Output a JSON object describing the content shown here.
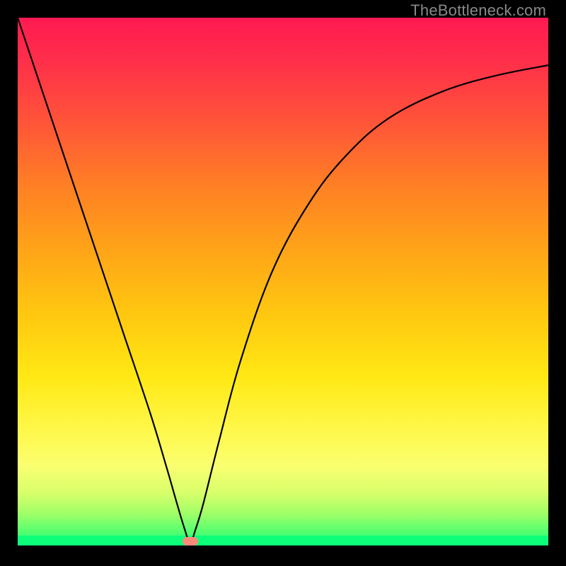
{
  "watermark": "TheBottleneck.com",
  "chart_data": {
    "type": "line",
    "title": "",
    "xlabel": "",
    "ylabel": "",
    "xlim": [
      0,
      100
    ],
    "ylim": [
      0,
      100
    ],
    "grid": false,
    "legend": false,
    "gradient_stops": [
      {
        "pct": 0,
        "color": "#ff1a52"
      },
      {
        "pct": 8,
        "color": "#ff2e4a"
      },
      {
        "pct": 20,
        "color": "#ff5538"
      },
      {
        "pct": 32,
        "color": "#ff8024"
      },
      {
        "pct": 44,
        "color": "#ffa418"
      },
      {
        "pct": 56,
        "color": "#ffc710"
      },
      {
        "pct": 68,
        "color": "#ffe814"
      },
      {
        "pct": 78,
        "color": "#fff84a"
      },
      {
        "pct": 85,
        "color": "#faff70"
      },
      {
        "pct": 90,
        "color": "#d8ff6a"
      },
      {
        "pct": 94,
        "color": "#a0ff68"
      },
      {
        "pct": 97,
        "color": "#5cff6e"
      },
      {
        "pct": 100,
        "color": "#1eff78"
      }
    ],
    "series": [
      {
        "name": "bottleneck-curve",
        "x": [
          0,
          5,
          10,
          15,
          20,
          25,
          28,
          30,
          31.5,
          32.5,
          33.5,
          35,
          38,
          42,
          48,
          55,
          62,
          70,
          80,
          90,
          100
        ],
        "y": [
          100,
          85,
          70,
          55,
          40,
          25,
          15,
          8,
          3,
          0.5,
          3,
          8,
          20,
          35,
          52,
          65,
          74,
          81,
          86,
          89,
          91
        ]
      }
    ],
    "marker": {
      "x": 32.5,
      "y": 0.8,
      "color": "#ff8a7a"
    }
  }
}
